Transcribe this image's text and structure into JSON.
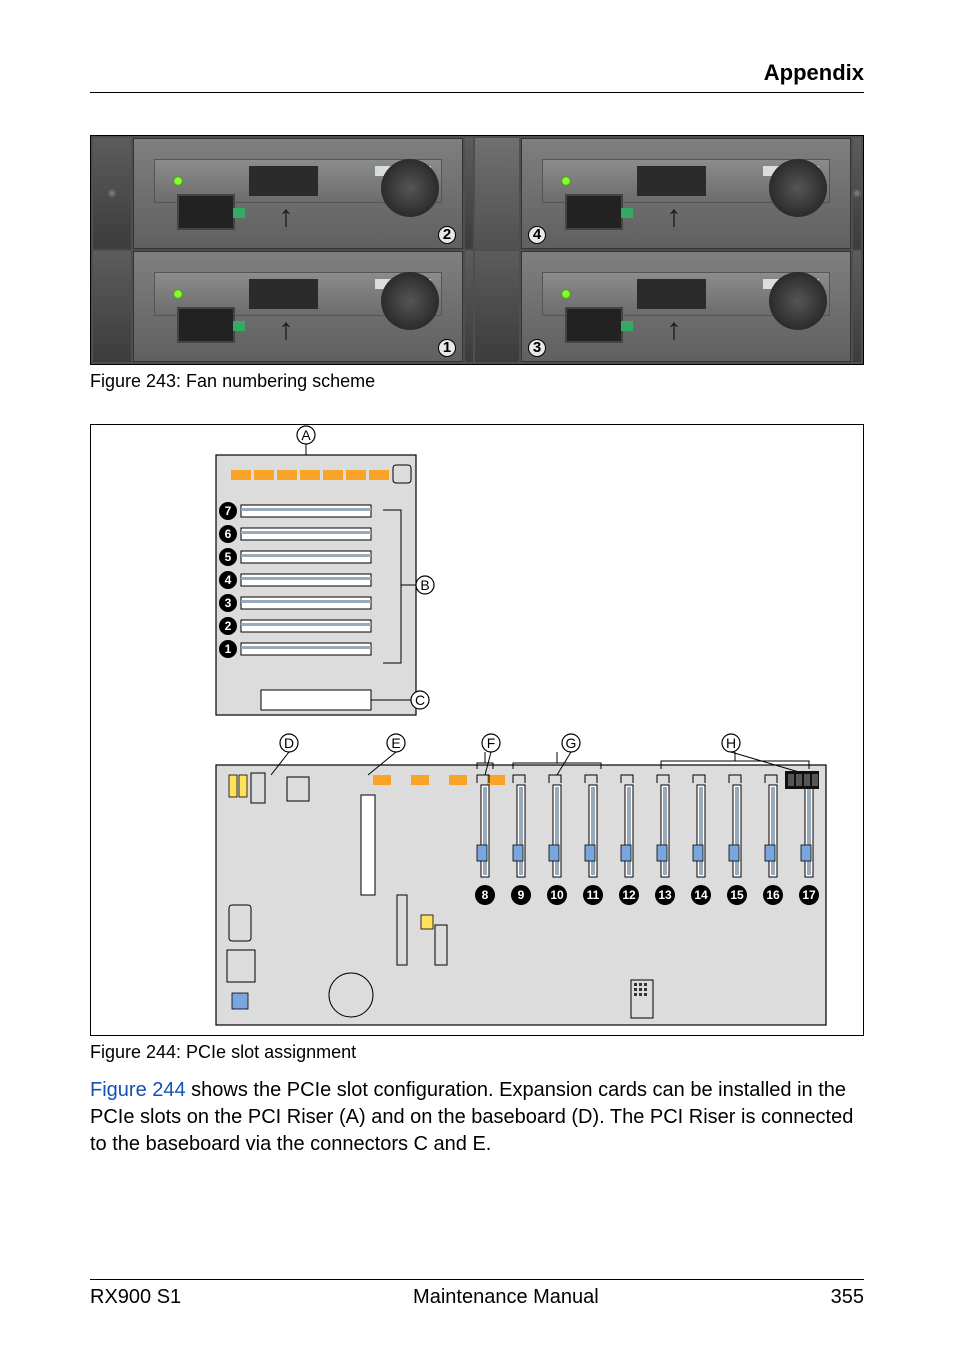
{
  "header": {
    "title": "Appendix"
  },
  "figures": {
    "fan": {
      "caption": "Figure 243: Fan numbering scheme",
      "bays": [
        {
          "pos": "top-left",
          "num": "2",
          "numSide": "r"
        },
        {
          "pos": "top-right",
          "num": "4",
          "numSide": "l"
        },
        {
          "pos": "bottom-left",
          "num": "1",
          "numSide": "r"
        },
        {
          "pos": "bottom-right",
          "num": "3",
          "numSide": "l"
        }
      ]
    },
    "pcie": {
      "caption": "Figure 244: PCIe slot assignment",
      "callouts_letters": [
        "A",
        "B",
        "C",
        "D",
        "E",
        "F",
        "G",
        "H"
      ],
      "riser_slots": [
        "7",
        "6",
        "5",
        "4",
        "3",
        "2",
        "1"
      ],
      "baseboard_slots": [
        "8",
        "9",
        "10",
        "11",
        "12",
        "13",
        "14",
        "15",
        "16",
        "17"
      ]
    }
  },
  "body": {
    "link": "Figure 244",
    "p1_rest": " shows the PCIe slot configuration. Expansion cards can be installed in the PCIe slots on the PCI Riser (A) and on the baseboard (D). The PCI Riser is connected to the baseboard via the connectors C and E."
  },
  "footer": {
    "left": "RX900 S1",
    "center": "Maintenance Manual",
    "right": "355"
  }
}
